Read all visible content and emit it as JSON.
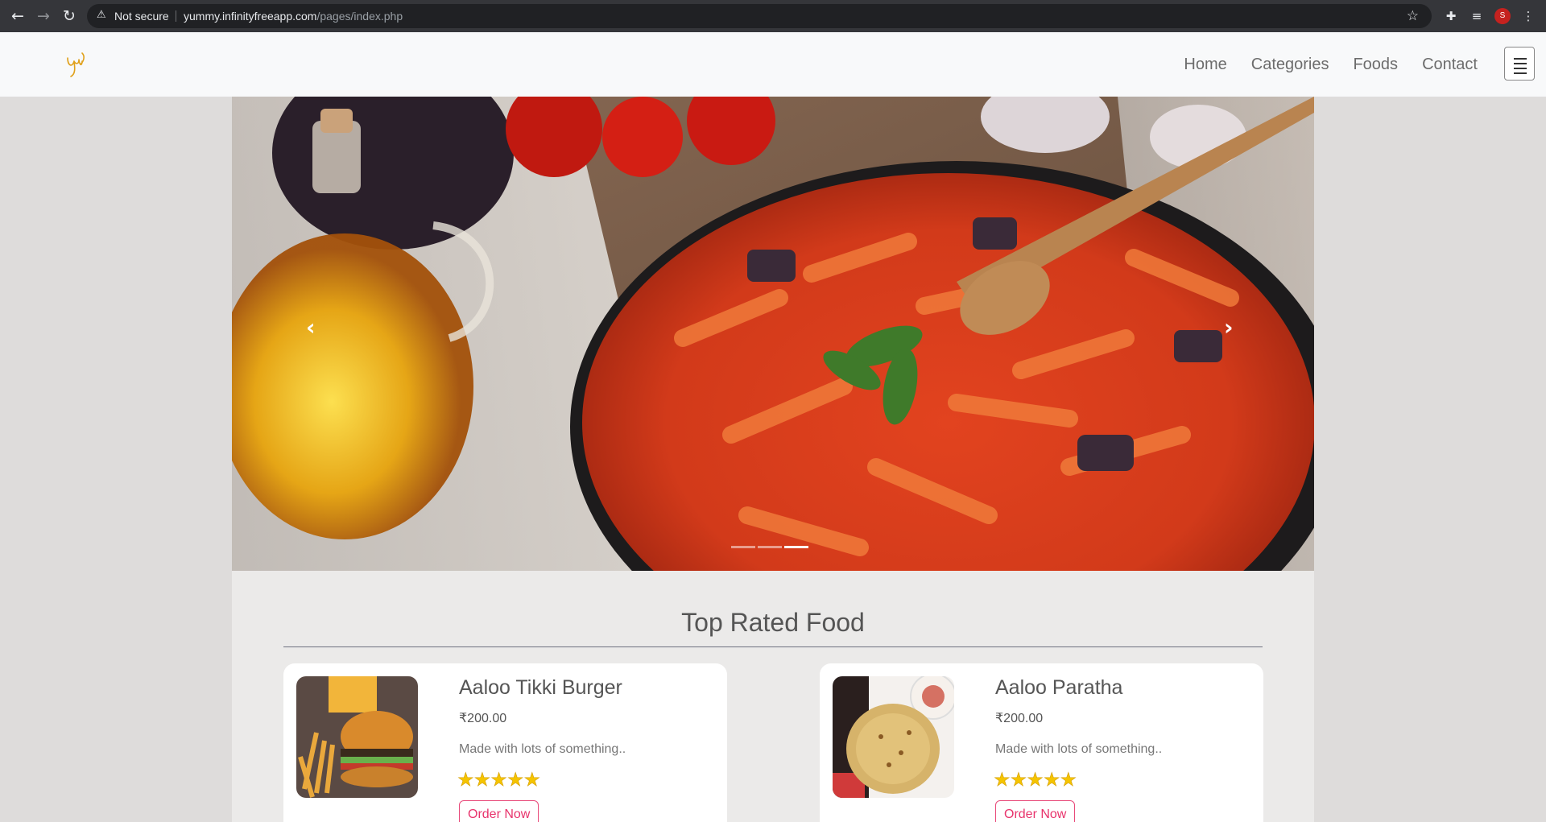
{
  "browser": {
    "security_label": "Not secure",
    "url_host": "yummy.infinityfreeapp.com",
    "url_path": "/pages/index.php",
    "profile_initial": "S"
  },
  "navbar": {
    "links": [
      "Home",
      "Categories",
      "Foods",
      "Contact"
    ]
  },
  "hero": {
    "slide_count": 3,
    "active_slide": 3,
    "prev_label": "‹",
    "next_label": "›"
  },
  "section": {
    "title": "Top Rated Food"
  },
  "foods": [
    {
      "name": "Aaloo Tikki Burger",
      "price": "₹200.00",
      "description": "Made with lots of something..",
      "rating": 5,
      "stars": "★★★★★",
      "button": "Order Now"
    },
    {
      "name": "Aaloo Paratha",
      "price": "₹200.00",
      "description": "Made with lots of something..",
      "rating": 5,
      "stars": "★★★★★",
      "button": "Order Now"
    }
  ],
  "colors": {
    "accent": "#e8336c",
    "star": "#f5c400",
    "page_bg": "#dedcdb",
    "navbar_bg": "#f8f9fa"
  }
}
